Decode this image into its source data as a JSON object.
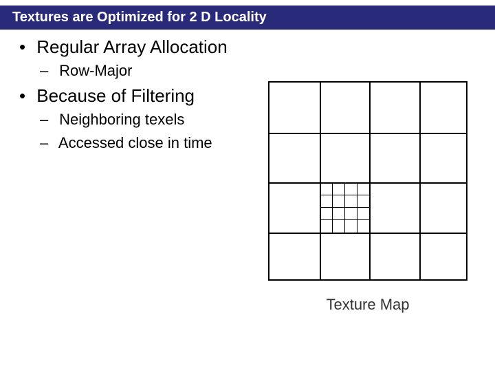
{
  "title": "Textures are Optimized for 2 D Locality",
  "bullets": [
    {
      "text": "Regular Array Allocation",
      "sub": [
        "Row-Major"
      ]
    },
    {
      "text": "Because of Filtering",
      "sub": [
        "Neighboring texels",
        "Accessed close in time"
      ]
    }
  ],
  "diagram_caption": "Texture Map"
}
